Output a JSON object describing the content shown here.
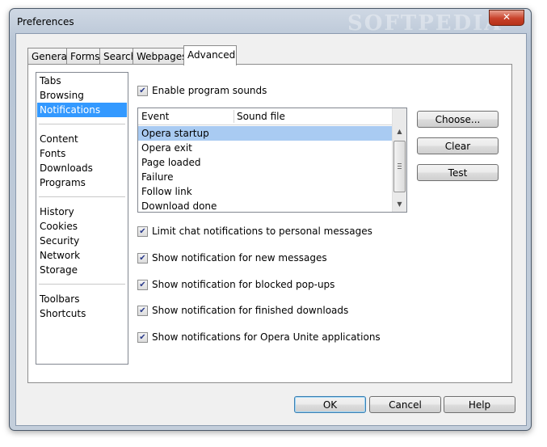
{
  "window": {
    "title": "Preferences",
    "watermark": "SOFTPEDIA",
    "close_label": "✕"
  },
  "tabs": [
    {
      "label": "General"
    },
    {
      "label": "Forms"
    },
    {
      "label": "Search"
    },
    {
      "label": "Webpages"
    },
    {
      "label": "Advanced"
    }
  ],
  "active_tab": "Advanced",
  "sidebar": {
    "groups": [
      [
        "Tabs",
        "Browsing",
        "Notifications"
      ],
      [
        "Content",
        "Fonts",
        "Downloads",
        "Programs"
      ],
      [
        "History",
        "Cookies",
        "Security",
        "Network",
        "Storage"
      ],
      [
        "Toolbars",
        "Shortcuts"
      ]
    ],
    "selected": "Notifications"
  },
  "enable_sounds": {
    "label": "Enable program sounds",
    "checked": true
  },
  "sound_list": {
    "columns": [
      "Event",
      "Sound file"
    ],
    "rows": [
      "Opera startup",
      "Opera exit",
      "Page loaded",
      "Failure",
      "Follow link",
      "Download done"
    ],
    "selected": "Opera startup"
  },
  "sound_buttons": {
    "choose": "Choose...",
    "clear": "Clear",
    "test": "Test"
  },
  "options": [
    {
      "label": "Limit chat notifications to personal messages",
      "checked": true
    },
    {
      "label": "Show notification for new messages",
      "checked": true
    },
    {
      "label": "Show notification for blocked pop-ups",
      "checked": true
    },
    {
      "label": "Show notification for finished downloads",
      "checked": true
    },
    {
      "label": "Show notifications for Opera Unite applications",
      "checked": true
    }
  ],
  "dialog_buttons": {
    "ok": "OK",
    "cancel": "Cancel",
    "help": "Help"
  },
  "colors": {
    "selection": "#3399ff",
    "list_selection": "#a9cbf2",
    "check": "#2a3a8a"
  }
}
